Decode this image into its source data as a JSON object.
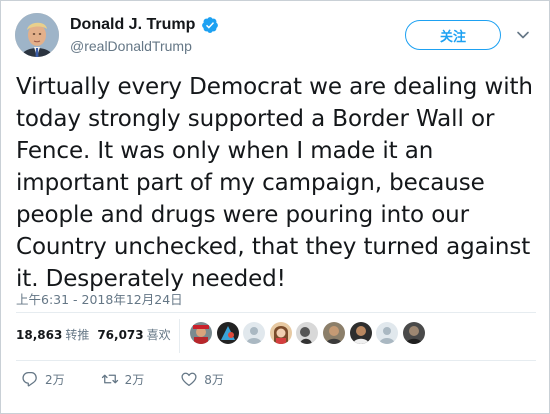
{
  "author": {
    "display_name": "Donald J. Trump",
    "handle": "@realDonaldTrump",
    "verified": true
  },
  "follow_button": {
    "label": "关注"
  },
  "tweet": {
    "text": "Virtually every Democrat we are dealing with today strongly supported a Border Wall or Fence. It was only when I made it an important part of my campaign, because people and drugs were pouring into our Country unchecked, that they turned against it. Desperately needed!",
    "timestamp": "上午6:31 - 2018年12月24日"
  },
  "stats": {
    "retweets": {
      "count": "18,863",
      "label": "转推"
    },
    "likes": {
      "count": "76,073",
      "label": "喜欢"
    }
  },
  "likers": [
    {
      "icon": "user-avatar"
    },
    {
      "icon": "user-avatar"
    },
    {
      "icon": "default-avatar"
    },
    {
      "icon": "user-avatar"
    },
    {
      "icon": "user-avatar"
    },
    {
      "icon": "user-avatar"
    },
    {
      "icon": "user-avatar"
    },
    {
      "icon": "default-avatar"
    },
    {
      "icon": "user-avatar"
    }
  ],
  "actions": {
    "reply": {
      "icon": "reply-icon",
      "count": "2万"
    },
    "retweet": {
      "icon": "retweet-icon",
      "count": "2万"
    },
    "like": {
      "icon": "heart-icon",
      "count": "8万"
    }
  },
  "colors": {
    "brand_blue": "#1da1f2",
    "text": "#14171a",
    "muted": "#657786",
    "border": "#e6ecf0"
  }
}
